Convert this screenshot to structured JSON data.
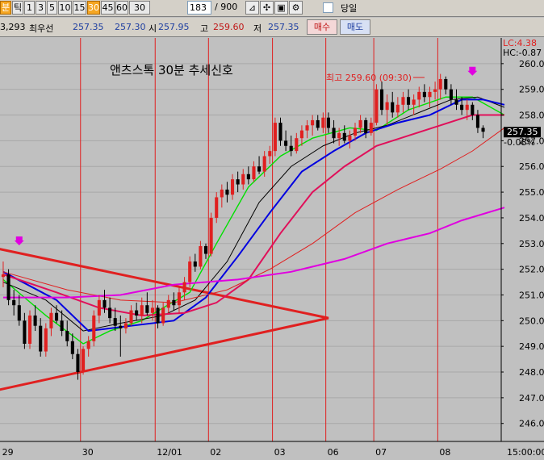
{
  "toolbar": {
    "buttons": [
      {
        "label": "분",
        "selected": true
      },
      {
        "label": "틱",
        "selected": false
      },
      {
        "label": "1",
        "selected": false
      },
      {
        "label": "3",
        "selected": false
      },
      {
        "label": "5",
        "selected": false
      },
      {
        "label": "10",
        "selected": false
      },
      {
        "label": "15",
        "selected": false
      },
      {
        "label": "30",
        "selected": true
      },
      {
        "label": "45",
        "selected": false
      },
      {
        "label": "60",
        "selected": false
      },
      {
        "label": "30",
        "selected": false
      }
    ],
    "count_value": "183",
    "total": "/ 900",
    "tool_icons": [
      "trend-tool-icon",
      "crosshair-tool-icon",
      "save-icon",
      "settings-icon"
    ],
    "checkbox_label": "당일"
  },
  "quote": {
    "volume": "3,293",
    "best_bid_label": "최우선",
    "bid": "257.35",
    "ask": "257.30",
    "open_label": "시",
    "open": "257.95",
    "high_label": "고",
    "high": "259.60",
    "low_label": "저",
    "low": "257.35",
    "buy_label": "매수",
    "sell_label": "매도"
  },
  "chart_title": "앤츠스톡 30분 추세신호",
  "annotation_high": "최고 259.60 (09:30)",
  "right_labels": {
    "lc": "LC:4.38",
    "hc": "HC:-0.87",
    "current": "257.35",
    "change": "-0.08%"
  },
  "colors": {
    "background": "#c0c0c0",
    "grid": "#a8a8a8",
    "vline": "#e02020",
    "candle_up": "#e02020",
    "candle_down": "#000000",
    "ma_green": "#00e000",
    "ma_black": "#000000",
    "ma_blue": "#0000e0",
    "ma_crimson": "#e0105a",
    "ma_thin_red": "#e02020",
    "ma_magenta": "#e000e0",
    "triangle": "#e02020",
    "arrow": "#e000e0"
  },
  "chart_data": {
    "type": "candlestick",
    "y_ticks": [
      246,
      247,
      248,
      249,
      250,
      251,
      252,
      253,
      254,
      255,
      256,
      257,
      258,
      259,
      260
    ],
    "ylim": [
      245.3,
      261.0
    ],
    "x_labels": [
      "29",
      "30",
      "12/01",
      "02",
      "03",
      "06",
      "07",
      "08"
    ],
    "x_end_label": "15:00:00",
    "last": 257.35,
    "high": 259.6,
    "sessions": [
      {
        "label": "29",
        "ohlc": [
          [
            251.7,
            252.3,
            251.3,
            251.8
          ],
          [
            251.8,
            252.0,
            250.6,
            250.8
          ],
          [
            250.8,
            251.2,
            250.2,
            250.6
          ],
          [
            250.6,
            251.0,
            249.8,
            250.0
          ],
          [
            250.0,
            250.3,
            248.9,
            249.1
          ],
          [
            249.1,
            250.4,
            248.9,
            250.2
          ],
          [
            250.2,
            250.6,
            249.6,
            249.8
          ],
          [
            249.8,
            250.1,
            248.6,
            248.8
          ],
          [
            248.8,
            249.9,
            248.6,
            249.7
          ],
          [
            249.7,
            250.5,
            249.4,
            250.3
          ],
          [
            250.3,
            250.6,
            249.9,
            250.0
          ],
          [
            250.0,
            250.4,
            249.4,
            249.6
          ],
          [
            249.6,
            250.0,
            249.0,
            249.2
          ],
          [
            249.2,
            249.5,
            248.5,
            248.7
          ],
          [
            248.7,
            248.9,
            247.7,
            248.0
          ]
        ]
      },
      {
        "label": "30",
        "ohlc": [
          [
            248.0,
            249.0,
            247.9,
            248.9
          ],
          [
            248.9,
            249.4,
            248.6,
            249.2
          ],
          [
            249.2,
            250.4,
            249.0,
            250.2
          ],
          [
            250.2,
            251.0,
            249.9,
            250.8
          ],
          [
            250.8,
            251.2,
            250.3,
            250.5
          ],
          [
            250.5,
            250.9,
            249.9,
            250.1
          ],
          [
            250.1,
            250.5,
            249.6,
            249.8
          ],
          [
            249.8,
            250.2,
            248.6,
            249.7
          ],
          [
            249.7,
            250.1,
            249.5,
            249.9
          ],
          [
            249.9,
            250.6,
            249.8,
            250.4
          ],
          [
            250.4,
            250.7,
            250.0,
            250.2
          ],
          [
            250.2,
            250.9,
            249.9,
            250.6
          ],
          [
            250.6,
            251.1,
            250.2,
            250.3
          ],
          [
            250.3,
            250.8,
            250.0,
            250.5
          ]
        ]
      },
      {
        "label": "12/01",
        "ohlc": [
          [
            250.5,
            250.6,
            249.7,
            249.9
          ],
          [
            249.9,
            250.7,
            249.8,
            250.5
          ],
          [
            250.5,
            251.0,
            250.3,
            250.8
          ],
          [
            250.8,
            251.1,
            250.4,
            250.6
          ],
          [
            250.6,
            251.3,
            250.3,
            251.1
          ],
          [
            251.1,
            251.7,
            250.8,
            251.5
          ],
          [
            251.5,
            252.5,
            251.3,
            252.3
          ],
          [
            252.3,
            252.6,
            251.9,
            252.1
          ],
          [
            252.1,
            253.1,
            252.0,
            252.9
          ],
          [
            252.9,
            253.0,
            252.4,
            252.6
          ]
        ]
      },
      {
        "label": "02",
        "ohlc": [
          [
            252.6,
            254.2,
            252.5,
            254.0
          ],
          [
            254.0,
            255.0,
            253.8,
            254.8
          ],
          [
            254.8,
            255.3,
            254.4,
            255.1
          ],
          [
            255.1,
            255.4,
            254.6,
            254.9
          ],
          [
            254.9,
            255.7,
            254.7,
            255.5
          ],
          [
            255.5,
            255.8,
            255.0,
            255.3
          ],
          [
            255.3,
            255.9,
            255.1,
            255.7
          ],
          [
            255.7,
            256.0,
            255.3,
            255.5
          ],
          [
            255.5,
            256.2,
            255.4,
            256.0
          ],
          [
            256.0,
            256.4,
            255.7,
            255.8
          ],
          [
            255.8,
            256.6,
            255.6,
            256.4
          ],
          [
            256.4,
            256.8,
            256.1,
            256.6
          ]
        ]
      },
      {
        "label": "03",
        "ohlc": [
          [
            256.6,
            257.9,
            256.4,
            257.7
          ],
          [
            257.7,
            257.9,
            256.8,
            257.0
          ],
          [
            257.0,
            257.4,
            256.6,
            256.8
          ],
          [
            256.8,
            257.2,
            256.4,
            256.6
          ],
          [
            256.6,
            257.3,
            256.5,
            257.1
          ],
          [
            257.1,
            257.6,
            256.8,
            257.4
          ],
          [
            257.4,
            257.8,
            257.1,
            257.6
          ],
          [
            257.6,
            258.0,
            257.2,
            257.8
          ],
          [
            257.8,
            258.0,
            257.4,
            257.5
          ],
          [
            257.5,
            258.1,
            257.3,
            257.9
          ]
        ]
      },
      {
        "label": "06",
        "ohlc": [
          [
            257.9,
            258.1,
            257.3,
            257.5
          ],
          [
            257.5,
            257.8,
            256.9,
            257.1
          ],
          [
            257.1,
            257.5,
            256.8,
            257.3
          ],
          [
            257.3,
            257.6,
            256.9,
            257.0
          ],
          [
            257.0,
            257.4,
            256.7,
            257.2
          ],
          [
            257.2,
            257.7,
            257.0,
            257.5
          ],
          [
            257.5,
            258.0,
            257.3,
            257.8
          ],
          [
            257.8,
            257.9,
            257.1,
            257.3
          ],
          [
            257.3,
            257.9,
            257.2,
            257.7
          ]
        ]
      },
      {
        "label": "07",
        "ohlc": [
          [
            257.7,
            259.2,
            257.6,
            259.0
          ],
          [
            259.0,
            259.3,
            258.0,
            258.2
          ],
          [
            258.2,
            258.8,
            257.6,
            258.5
          ],
          [
            258.5,
            258.9,
            257.9,
            258.1
          ],
          [
            258.1,
            258.7,
            257.9,
            258.4
          ],
          [
            258.4,
            258.9,
            258.1,
            258.7
          ],
          [
            258.7,
            259.0,
            258.2,
            258.4
          ],
          [
            258.4,
            258.8,
            258.0,
            258.6
          ],
          [
            258.6,
            259.1,
            258.3,
            258.9
          ],
          [
            258.9,
            259.2,
            258.5,
            258.7
          ],
          [
            258.7,
            259.1,
            258.3,
            258.9
          ],
          [
            258.9,
            259.3,
            258.6,
            259.0
          ]
        ]
      },
      {
        "label": "08",
        "ohlc": [
          [
            259.0,
            259.6,
            258.6,
            259.4
          ],
          [
            259.4,
            259.5,
            258.8,
            259.0
          ],
          [
            259.0,
            259.2,
            258.4,
            258.6
          ],
          [
            258.6,
            259.0,
            258.2,
            258.4
          ],
          [
            258.4,
            258.7,
            258.0,
            258.2
          ],
          [
            258.2,
            258.6,
            257.8,
            258.4
          ],
          [
            258.4,
            258.5,
            257.8,
            258.0
          ],
          [
            258.0,
            258.2,
            257.3,
            257.5
          ],
          [
            257.5,
            257.6,
            257.1,
            257.35
          ]
        ]
      }
    ],
    "moving_averages": [
      {
        "color": "#00e000",
        "width": 1.4,
        "points": [
          [
            0,
            251.6
          ],
          [
            8,
            250.2
          ],
          [
            15,
            249.1
          ],
          [
            20,
            249.6
          ],
          [
            26,
            250.0
          ],
          [
            30,
            250.5
          ],
          [
            35,
            251.1
          ],
          [
            40,
            253.0
          ],
          [
            46,
            255.2
          ],
          [
            52,
            256.4
          ],
          [
            58,
            257.1
          ],
          [
            65,
            257.5
          ],
          [
            70,
            257.4
          ],
          [
            76,
            258.2
          ],
          [
            83,
            258.7
          ],
          [
            88,
            258.7
          ],
          [
            94,
            258.0
          ]
        ]
      },
      {
        "color": "#000000",
        "width": 1,
        "points": [
          [
            0,
            251.5
          ],
          [
            8,
            250.8
          ],
          [
            15,
            249.6
          ],
          [
            22,
            249.9
          ],
          [
            30,
            250.2
          ],
          [
            36,
            250.8
          ],
          [
            42,
            252.3
          ],
          [
            48,
            254.6
          ],
          [
            54,
            256.0
          ],
          [
            60,
            256.8
          ],
          [
            66,
            257.3
          ],
          [
            72,
            257.6
          ],
          [
            78,
            258.1
          ],
          [
            84,
            258.6
          ],
          [
            89,
            258.7
          ],
          [
            94,
            258.3
          ]
        ]
      },
      {
        "color": "#0000e0",
        "width": 2,
        "points": [
          [
            0,
            251.9
          ],
          [
            10,
            250.8
          ],
          [
            16,
            249.6
          ],
          [
            24,
            249.8
          ],
          [
            32,
            250.0
          ],
          [
            38,
            250.9
          ],
          [
            44,
            252.5
          ],
          [
            50,
            254.2
          ],
          [
            56,
            255.8
          ],
          [
            62,
            256.6
          ],
          [
            68,
            257.3
          ],
          [
            74,
            257.7
          ],
          [
            80,
            258.0
          ],
          [
            86,
            258.6
          ],
          [
            90,
            258.6
          ],
          [
            94,
            258.4
          ]
        ]
      },
      {
        "color": "#e0105a",
        "width": 2,
        "points": [
          [
            0,
            251.8
          ],
          [
            10,
            251.1
          ],
          [
            18,
            250.5
          ],
          [
            26,
            250.2
          ],
          [
            34,
            250.3
          ],
          [
            40,
            250.7
          ],
          [
            46,
            251.6
          ],
          [
            52,
            253.4
          ],
          [
            58,
            255.0
          ],
          [
            64,
            256.0
          ],
          [
            70,
            256.8
          ],
          [
            76,
            257.2
          ],
          [
            82,
            257.6
          ],
          [
            88,
            258.0
          ],
          [
            94,
            258.0
          ]
        ]
      },
      {
        "color": "#e02020",
        "width": 1,
        "points": [
          [
            0,
            251.9
          ],
          [
            12,
            251.2
          ],
          [
            22,
            250.8
          ],
          [
            32,
            250.7
          ],
          [
            42,
            251.2
          ],
          [
            50,
            252.0
          ],
          [
            58,
            253.0
          ],
          [
            66,
            254.2
          ],
          [
            74,
            255.1
          ],
          [
            82,
            255.9
          ],
          [
            88,
            256.6
          ],
          [
            94,
            257.5
          ]
        ]
      },
      {
        "color": "#e000e0",
        "width": 2,
        "points": [
          [
            0,
            250.9
          ],
          [
            12,
            250.9
          ],
          [
            22,
            251.0
          ],
          [
            32,
            251.4
          ],
          [
            44,
            251.6
          ],
          [
            54,
            251.9
          ],
          [
            64,
            252.4
          ],
          [
            72,
            253.0
          ],
          [
            80,
            253.4
          ],
          [
            86,
            253.9
          ],
          [
            94,
            254.4
          ]
        ]
      }
    ],
    "triangle": [
      [
        -1,
        252.8
      ],
      [
        61,
        250.1
      ],
      [
        -1,
        247.3
      ]
    ],
    "signal_arrows": [
      [
        3,
        252.9
      ],
      [
        88,
        259.5
      ]
    ]
  }
}
